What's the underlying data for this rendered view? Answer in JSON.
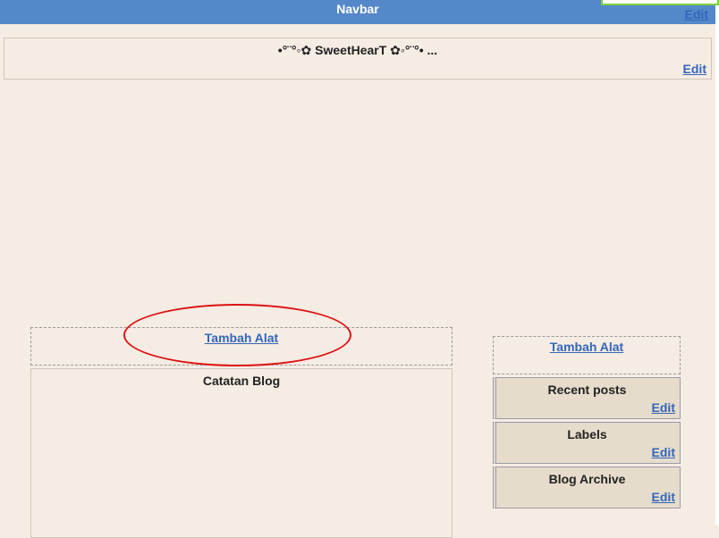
{
  "navbar": {
    "title": "Navbar",
    "edit_label": "Edit"
  },
  "header": {
    "title": "•°¨°◦✿ SweetHearT ✿◦°¨°• ...",
    "edit_label": "Edit"
  },
  "main": {
    "add_gadget_label": "Tambah Alat",
    "blog_posts_title": "Catatan Blog"
  },
  "sidebar": {
    "add_gadget_label": "Tambah Alat",
    "widgets": [
      {
        "title": "Recent posts",
        "edit_label": "Edit"
      },
      {
        "title": "Labels",
        "edit_label": "Edit"
      },
      {
        "title": "Blog Archive",
        "edit_label": "Edit"
      }
    ]
  },
  "colors": {
    "navbar": "#5588c8",
    "background": "#f5ece3",
    "link": "#3366bb",
    "highlight": "#dd1111",
    "widget_bg": "#e6dccc"
  }
}
